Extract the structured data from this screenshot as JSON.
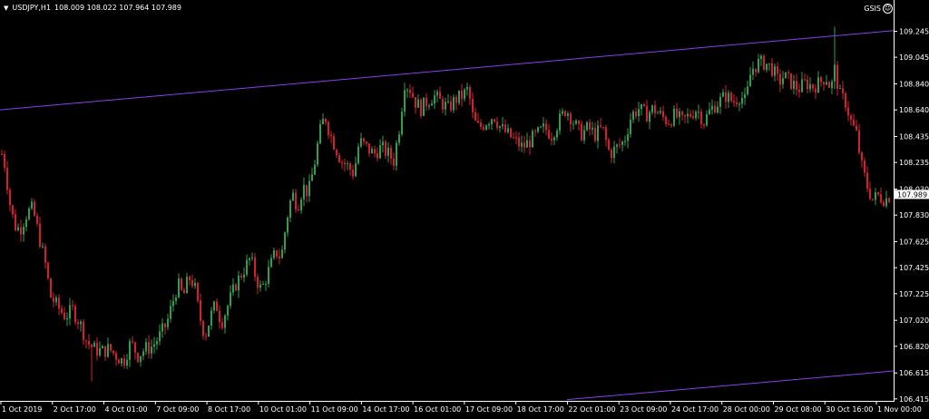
{
  "window": {
    "symbol_timeframe": "USDJPY,H1",
    "ohlc": "108.009 108.022 107.964 107.989",
    "indicator_label": "GSIS"
  },
  "colors": {
    "background": "#000000",
    "bull": "#2e9e4f",
    "bear": "#d61f2c",
    "channel": "#8a3cf0",
    "axis": "#ffffff",
    "price_tag_bg": "#ffffff"
  },
  "chart_data": {
    "type": "candlestick",
    "symbol": "USDJPY",
    "timeframe": "H1",
    "y_ticks": [
      "109.245",
      "109.045",
      "108.840",
      "108.640",
      "108.435",
      "108.235",
      "108.030",
      "107.830",
      "107.625",
      "107.425",
      "107.225",
      "107.020",
      "106.820",
      "106.615",
      "106.415"
    ],
    "x_ticks": [
      "1 Oct 2019",
      "2 Oct 17:00",
      "4 Oct 01:00",
      "7 Oct 09:00",
      "8 Oct 17:00",
      "10 Oct 01:00",
      "11 Oct 09:00",
      "14 Oct 17:00",
      "16 Oct 01:00",
      "17 Oct 09:00",
      "18 Oct 17:00",
      "22 Oct 01:00",
      "23 Oct 09:00",
      "24 Oct 17:00",
      "28 Oct 00:00",
      "29 Oct 08:00",
      "30 Oct 16:00",
      "1 Nov 00:00"
    ],
    "ylim": [
      106.4,
      109.36
    ],
    "current_price": "107.989",
    "close_path": [
      [
        0,
        108.35
      ],
      [
        6,
        108.2
      ],
      [
        10,
        107.95
      ],
      [
        16,
        107.75
      ],
      [
        22,
        107.72
      ],
      [
        30,
        107.85
      ],
      [
        36,
        107.88
      ],
      [
        42,
        107.7
      ],
      [
        50,
        107.45
      ],
      [
        56,
        107.2
      ],
      [
        64,
        107.12
      ],
      [
        72,
        107.05
      ],
      [
        80,
        107.1
      ],
      [
        88,
        107.0
      ],
      [
        96,
        106.85
      ],
      [
        104,
        106.8
      ],
      [
        112,
        106.78
      ],
      [
        120,
        106.8
      ],
      [
        128,
        106.75
      ],
      [
        136,
        106.7
      ],
      [
        144,
        106.85
      ],
      [
        152,
        106.75
      ],
      [
        160,
        106.8
      ],
      [
        168,
        106.82
      ],
      [
        176,
        106.9
      ],
      [
        184,
        107.0
      ],
      [
        190,
        107.15
      ],
      [
        196,
        107.3
      ],
      [
        202,
        107.2
      ],
      [
        208,
        107.35
      ],
      [
        214,
        107.3
      ],
      [
        220,
        107.05
      ],
      [
        226,
        106.9
      ],
      [
        232,
        107.05
      ],
      [
        238,
        107.15
      ],
      [
        244,
        107.0
      ],
      [
        252,
        107.15
      ],
      [
        260,
        107.3
      ],
      [
        268,
        107.4
      ],
      [
        276,
        107.5
      ],
      [
        282,
        107.35
      ],
      [
        288,
        107.25
      ],
      [
        296,
        107.4
      ],
      [
        304,
        107.55
      ],
      [
        310,
        107.5
      ],
      [
        316,
        107.8
      ],
      [
        322,
        108.0
      ],
      [
        328,
        107.9
      ],
      [
        334,
        108.05
      ],
      [
        340,
        108.0
      ],
      [
        346,
        108.2
      ],
      [
        352,
        108.45
      ],
      [
        358,
        108.6
      ],
      [
        364,
        108.45
      ],
      [
        370,
        108.35
      ],
      [
        376,
        108.25
      ],
      [
        384,
        108.2
      ],
      [
        390,
        108.15
      ],
      [
        396,
        108.4
      ],
      [
        404,
        108.35
      ],
      [
        412,
        108.3
      ],
      [
        420,
        108.35
      ],
      [
        428,
        108.3
      ],
      [
        434,
        108.25
      ],
      [
        440,
        108.5
      ],
      [
        446,
        108.85
      ],
      [
        452,
        108.8
      ],
      [
        458,
        108.7
      ],
      [
        464,
        108.65
      ],
      [
        470,
        108.7
      ],
      [
        478,
        108.75
      ],
      [
        486,
        108.7
      ],
      [
        494,
        108.65
      ],
      [
        502,
        108.72
      ],
      [
        510,
        108.75
      ],
      [
        516,
        108.8
      ],
      [
        522,
        108.55
      ],
      [
        528,
        108.5
      ],
      [
        536,
        108.55
      ],
      [
        544,
        108.6
      ],
      [
        552,
        108.5
      ],
      [
        560,
        108.45
      ],
      [
        568,
        108.4
      ],
      [
        576,
        108.35
      ],
      [
        584,
        108.4
      ],
      [
        592,
        108.45
      ],
      [
        600,
        108.5
      ],
      [
        608,
        108.45
      ],
      [
        616,
        108.55
      ],
      [
        624,
        108.65
      ],
      [
        632,
        108.55
      ],
      [
        640,
        108.45
      ],
      [
        648,
        108.5
      ],
      [
        656,
        108.45
      ],
      [
        664,
        108.5
      ],
      [
        672,
        108.3
      ],
      [
        680,
        108.35
      ],
      [
        688,
        108.4
      ],
      [
        696,
        108.6
      ],
      [
        704,
        108.65
      ],
      [
        712,
        108.6
      ],
      [
        720,
        108.65
      ],
      [
        728,
        108.6
      ],
      [
        736,
        108.55
      ],
      [
        744,
        108.6
      ],
      [
        752,
        108.55
      ],
      [
        760,
        108.6
      ],
      [
        768,
        108.65
      ],
      [
        776,
        108.55
      ],
      [
        784,
        108.65
      ],
      [
        792,
        108.7
      ],
      [
        800,
        108.75
      ],
      [
        808,
        108.7
      ],
      [
        816,
        108.75
      ],
      [
        822,
        108.7
      ],
      [
        828,
        108.95
      ],
      [
        836,
        109.0
      ],
      [
        844,
        109.0
      ],
      [
        852,
        108.95
      ],
      [
        858,
        108.85
      ],
      [
        864,
        108.9
      ],
      [
        872,
        108.85
      ],
      [
        880,
        108.8
      ],
      [
        888,
        108.85
      ],
      [
        896,
        108.82
      ],
      [
        904,
        108.85
      ],
      [
        910,
        108.9
      ],
      [
        916,
        108.8
      ],
      [
        920,
        108.95
      ],
      [
        926,
        108.75
      ],
      [
        932,
        108.7
      ],
      [
        938,
        108.55
      ],
      [
        944,
        108.45
      ],
      [
        950,
        108.2
      ],
      [
        956,
        108.05
      ],
      [
        962,
        107.95
      ],
      [
        968,
        107.98
      ],
      [
        976,
        107.95
      ],
      [
        982,
        107.99
      ]
    ],
    "spike_high": 109.28,
    "channel_lines": [
      {
        "from": [
          0,
          108.64
        ],
        "to": [
          985,
          109.25
        ]
      },
      {
        "from": [
          625,
          106.41
        ],
        "to": [
          985,
          106.63
        ]
      }
    ]
  }
}
